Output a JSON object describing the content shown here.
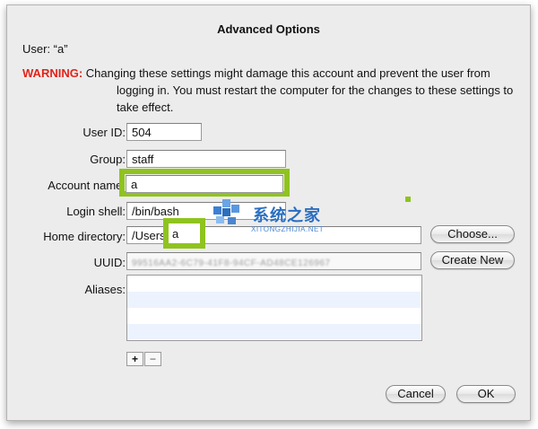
{
  "dialog": {
    "title": "Advanced Options",
    "user_line": "User: “a”",
    "warning_label": "WARNING:",
    "warning_text_1": "Changing these settings might damage this account and prevent the user from",
    "warning_text_2": "logging in. You must restart the computer for the changes to these settings to",
    "warning_text_3": "take effect."
  },
  "fields": {
    "user_id": {
      "label": "User ID:",
      "value": "504"
    },
    "group": {
      "label": "Group:",
      "value": "staff"
    },
    "account_name": {
      "label": "Account name:",
      "value": "a"
    },
    "login_shell": {
      "label": "Login shell:",
      "value": "/bin/bash"
    },
    "home_directory": {
      "label": "Home directory:",
      "value_prefix": "/Users",
      "value_user": "a"
    },
    "uuid": {
      "label": "UUID:",
      "value": "99516AA2-6C79-41F8-94CF-AD48CE126967"
    },
    "aliases": {
      "label": "Aliases:"
    }
  },
  "buttons": {
    "choose": "Choose...",
    "create_new": "Create New",
    "add": "+",
    "remove": "−",
    "cancel": "Cancel",
    "ok": "OK"
  },
  "watermark": {
    "text": "系统之家",
    "sub": "XITONGZHIJIA.NET"
  },
  "colors": {
    "warning": "#e2231a",
    "highlight": "#8fc31f",
    "watermark": "#2a6fc0"
  }
}
